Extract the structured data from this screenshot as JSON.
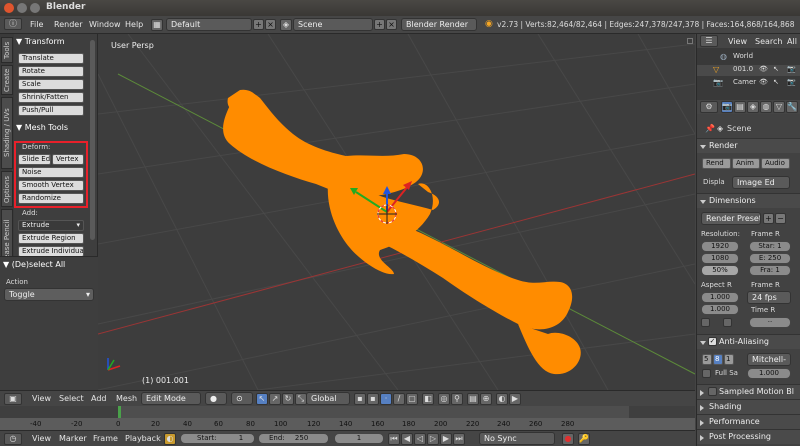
{
  "window": {
    "title": "Blender"
  },
  "menubar": {
    "items": [
      "File",
      "Render",
      "Window",
      "Help"
    ],
    "layout_value": "Default",
    "scene_value": "Scene",
    "engine_value": "Blender Render",
    "stats": "v2.73 | Verts:82,464/82,464 | Edges:247,378/247,378 | Faces:164,868/164,868 | Tris:164,868"
  },
  "side_tabs": [
    "Tools",
    "Create",
    "Shading / UVs",
    "Options",
    "Grease Pencil"
  ],
  "toolshelf": {
    "transform_header": "Transform",
    "transform_buttons": [
      "Translate",
      "Rotate",
      "Scale",
      "Shrink/Fatten",
      "Push/Pull"
    ],
    "mesh_tools_header": "Mesh Tools",
    "deform_label": "Deform:",
    "deform_row": [
      "Slide Ed",
      "Vertex"
    ],
    "deform_buttons": [
      "Noise",
      "Smooth Vertex",
      "Randomize"
    ],
    "add_label": "Add:",
    "extrude_value": "Extrude",
    "add_buttons": [
      "Extrude Region",
      "Extrude Individual"
    ],
    "operator_header": "(De)select All",
    "action_label": "Action",
    "action_value": "Toggle"
  },
  "viewport": {
    "view_label": "User Persp",
    "object_label": "(1) 001.001",
    "mesh_color": "#ff8c00",
    "highlight_color": "#e8202a"
  },
  "view_header": {
    "menus": [
      "View",
      "Select",
      "Add",
      "Mesh"
    ],
    "mode_value": "Edit Mode",
    "orientation_value": "Global"
  },
  "timeline": {
    "ticks": [
      "-40",
      "-20",
      "0",
      "20",
      "40",
      "60",
      "80",
      "100",
      "120",
      "140",
      "160",
      "180",
      "200",
      "220",
      "240",
      "260",
      "280"
    ],
    "menus": [
      "View",
      "Marker",
      "Frame",
      "Playback"
    ],
    "start_label": "Start:",
    "start_value": "1",
    "end_label": "End:",
    "end_value": "250",
    "current_value": "1",
    "sync_value": "No Sync"
  },
  "outliner": {
    "menus": [
      "View",
      "Search",
      "All"
    ],
    "items": [
      "World",
      "001.0",
      "Camer"
    ]
  },
  "properties": {
    "context": "Scene",
    "render_header": "Render",
    "render_buttons": [
      "Rend",
      "Anim",
      "Audio"
    ],
    "display_label": "Displa",
    "display_value": "Image Ed",
    "dimensions_header": "Dimensions",
    "presets_value": "Render Presets",
    "resolution_label": "Resolution:",
    "frame_range_label": "Frame R",
    "res_x": "1920",
    "res_y": "1080",
    "res_pct": "50%",
    "start": "Star: 1",
    "end": "E: 250",
    "step": "Fra: 1",
    "aspect_label": "Aspect R",
    "frame_rate_label": "Frame R",
    "aspect_x": "1.000",
    "aspect_y": "1.000",
    "fps_value": "24 fps",
    "time_label": "Time R",
    "aa_header": "Anti-Aliasing",
    "aa_samples": [
      "5",
      "8",
      "1"
    ],
    "aa_filter": "Mitchell-",
    "full_sample_label": "Full Sa",
    "aa_size": "1.000",
    "collapsed_sections": [
      "Sampled Motion Bl",
      "Shading",
      "Performance",
      "Post Processing"
    ]
  }
}
